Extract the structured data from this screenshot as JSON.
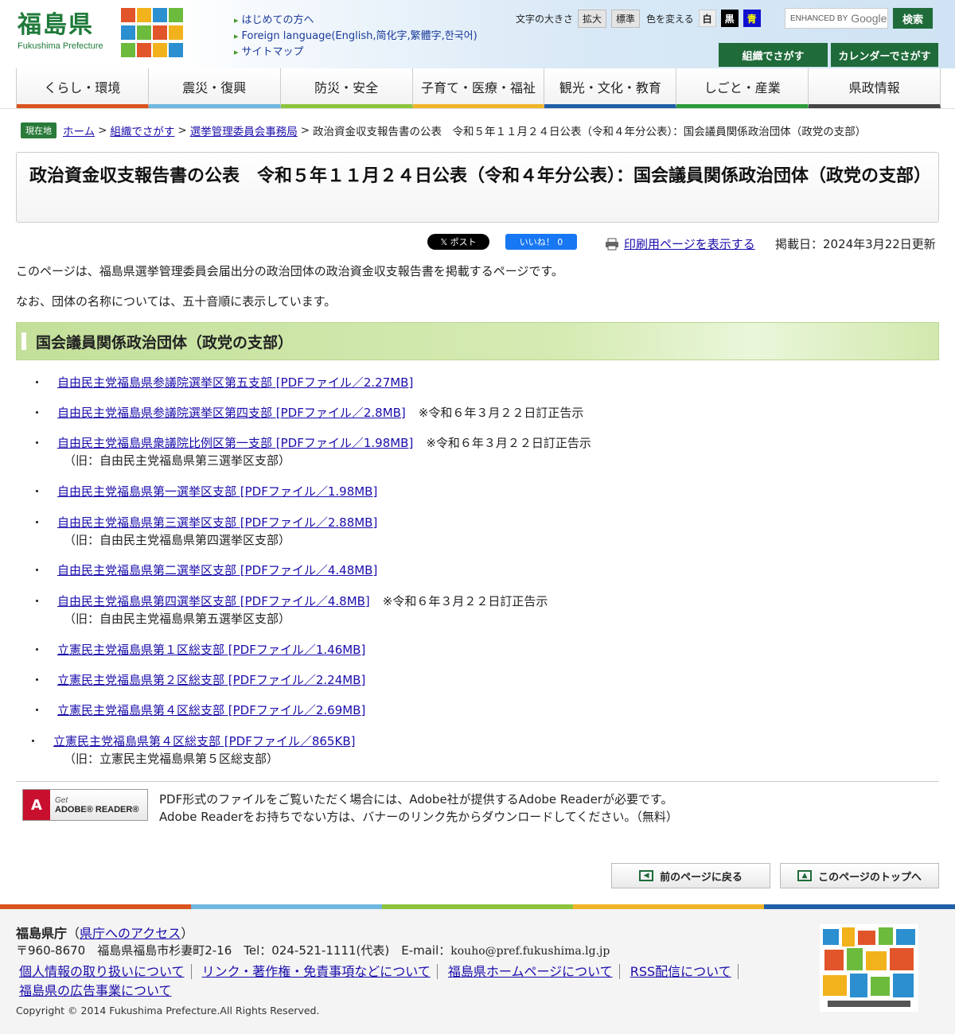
{
  "header": {
    "logo_kanji": "福島県",
    "logo_roman": "Fukushima Prefecture",
    "links": [
      "はじめての方へ",
      "Foreign language(English,简化字,繁體字,한국어)",
      "サイトマップ"
    ],
    "font_size_label": "文字の大きさ",
    "font_enlarge": "拡大",
    "font_standard": "標準",
    "color_label": "色を変える",
    "color_white": "白",
    "color_black": "黒",
    "color_blue": "青",
    "search_enhanced": "ENHANCED BY",
    "search_google": "Google",
    "search_button": "検索",
    "org_button": "組織でさがす",
    "calendar_button": "カレンダーでさがす"
  },
  "nav": [
    {
      "label": "くらし・環境",
      "color": "#d9541e"
    },
    {
      "label": "震災・復興",
      "color": "#6fb7e0"
    },
    {
      "label": "防災・安全",
      "color": "#8cc43c"
    },
    {
      "label": "子育て・医療・福祉",
      "color": "#f0b428"
    },
    {
      "label": "観光・文化・教育",
      "color": "#1f5fa8"
    },
    {
      "label": "しごと・産業",
      "color": "#2a9a3a"
    },
    {
      "label": "県政情報",
      "color": "#444444"
    }
  ],
  "breadcrumb": {
    "tag": "現在地",
    "home": "ホーム",
    "org": "組織でさがす",
    "dept": "選挙管理委員会事務局",
    "current": "政治資金収支報告書の公表　令和５年１１月２４日公表（令和４年分公表）：国会議員関係政治団体（政党の支部）",
    "sep": ">"
  },
  "page_title": "政治資金収支報告書の公表　令和５年１１月２４日公表（令和４年分公表）：国会議員関係政治団体（政党の支部）",
  "social": {
    "x_label": "𝕏 ポスト",
    "fb_label": "いいね！ 0"
  },
  "print_link": "印刷用ページを表示する",
  "updated": "掲載日：2024年3月22日更新",
  "intro1": "このページは、福島県選挙管理委員会届出分の政治団体の政治資金収支報告書を掲載するページです。",
  "intro2": "なお、団体の名称については、五十音順に表示しています。",
  "section_heading": "国会議員関係政治団体（政党の支部）",
  "items": [
    {
      "link": "自由民主党福島県参議院選挙区第五支部 [PDFファイル／2.27MB]",
      "note": "",
      "sub": ""
    },
    {
      "link": "自由民主党福島県参議院選挙区第四支部 [PDFファイル／2.8MB]",
      "note": "※令和６年３月２２日訂正告示",
      "sub": ""
    },
    {
      "link": "自由民主党福島県衆議院比例区第一支部 [PDFファイル／1.98MB]",
      "note": "※令和６年３月２２日訂正告示",
      "sub": "（旧：自由民主党福島県第三選挙区支部）"
    },
    {
      "link": "自由民主党福島県第一選挙区支部 [PDFファイル／1.98MB]",
      "note": "",
      "sub": ""
    },
    {
      "link": "自由民主党福島県第三選挙区支部 [PDFファイル／2.88MB]",
      "note": "",
      "sub": "（旧：自由民主党福島県第四選挙区支部）"
    },
    {
      "link": "自由民主党福島県第二選挙区支部 [PDFファイル／4.48MB]",
      "note": "",
      "sub": ""
    },
    {
      "link": "自由民主党福島県第四選挙区支部 [PDFファイル／4.8MB]",
      "note": "※令和６年３月２２日訂正告示",
      "sub": "（旧：自由民主党福島県第五選挙区支部）"
    },
    {
      "link": "立憲民主党福島県第１区総支部 [PDFファイル／1.46MB]",
      "note": "",
      "sub": ""
    },
    {
      "link": "立憲民主党福島県第２区総支部 [PDFファイル／2.24MB]",
      "note": "",
      "sub": ""
    },
    {
      "link": "立憲民主党福島県第４区総支部 [PDFファイル／2.69MB]",
      "note": "",
      "sub": ""
    },
    {
      "link": "立憲民主党福島県第４区総支部 [PDFファイル／865KB]",
      "note": "",
      "sub": "（旧：立憲民主党福島県第５区総支部）"
    }
  ],
  "adobe": {
    "banner_get": "Get",
    "banner_name": "ADOBE® READER®",
    "line1": "PDF形式のファイルをご覧いただく場合には、Adobe社が提供するAdobe Readerが必要です。",
    "line2": "Adobe Readerをお持ちでない方は、バナーのリンク先からダウンロードしてください。（無料）"
  },
  "back_button": "前のページに戻る",
  "top_button": "このページのトップへ",
  "footer": {
    "office": "福島県庁",
    "access": "県庁へのアクセス",
    "address": "〒960-8670　福島県福島市杉妻町2-16　Tel：024-521-1111(代表)　E-mail：",
    "email": "kouho@pref.fukushima.lg.jp",
    "links": [
      "個人情報の取り扱いについて",
      "リンク・著作権・免責事項などについて",
      "福島県ホームページについて",
      "RSS配信について",
      "福島県の広告事業について"
    ],
    "copyright": "Copyright © 2014 Fukushima Prefecture.All Rights Reserved."
  }
}
